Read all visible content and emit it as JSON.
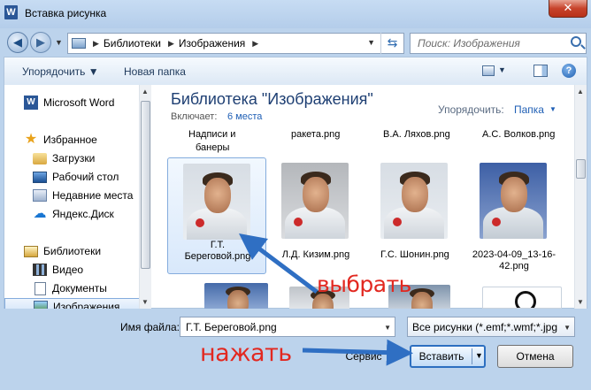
{
  "window": {
    "title": "Вставка рисунка",
    "app_icon_letter": "W",
    "close_glyph": "✕"
  },
  "navigation": {
    "back_glyph": "◀",
    "forward_glyph": "▶",
    "recent_drop_glyph": "▼",
    "breadcrumbs": [
      "Библиотеки",
      "Изображения"
    ],
    "crumb_sep_glyph": "▶",
    "addr_drop_glyph": "▼",
    "refresh_glyph": "⇆",
    "search_placeholder": "Поиск: Изображения"
  },
  "toolbar": {
    "organize_label": "Упорядочить ▼",
    "new_folder_label": "Новая папка",
    "view_drop_glyph": "▼",
    "help_glyph": "?"
  },
  "sidebar": {
    "items": [
      {
        "label": "Microsoft Word",
        "icon": "word-icon"
      },
      {
        "label": "Избранное",
        "icon": "star-icon"
      },
      {
        "label": "Загрузки",
        "icon": "downloads-folder-icon"
      },
      {
        "label": "Рабочий стол",
        "icon": "desktop-icon"
      },
      {
        "label": "Недавние места",
        "icon": "recent-places-icon"
      },
      {
        "label": "Яндекс.Диск",
        "icon": "yandex-disk-icon"
      },
      {
        "label": "Библиотеки",
        "icon": "libraries-icon"
      },
      {
        "label": "Видео",
        "icon": "video-library-icon"
      },
      {
        "label": "Документы",
        "icon": "documents-library-icon"
      },
      {
        "label": "Изображения",
        "icon": "images-library-icon"
      }
    ],
    "selected": "Изображения"
  },
  "library": {
    "title": "Библиотека \"Изображения\"",
    "includes_label": "Включает:",
    "places_link": "6 места",
    "arrange_label": "Упорядочить:",
    "arrange_value": "Папка",
    "arrange_drop_glyph": "▼"
  },
  "files": {
    "cut_row": [
      {
        "label": "Надписи и"
      },
      {
        "label": "банеры"
      },
      {
        "label": "ракета.png"
      },
      {
        "label": "В.А. Ляхов.png"
      },
      {
        "label": "А.С. Волков.png"
      }
    ],
    "tiles": [
      {
        "line1": "Г.Т.",
        "line2": "Береговой.png",
        "selected": true
      },
      {
        "line1": "Л.Д. Кизим.png",
        "line2": "",
        "selected": false
      },
      {
        "line1": "Г.С. Шонин.png",
        "line2": "",
        "selected": false
      },
      {
        "line1": "2023-04-09_13-16-",
        "line2": "42.png",
        "selected": false
      }
    ]
  },
  "footer": {
    "filename_label": "Имя файла:",
    "filename_value": "Г.Т. Береговой.png",
    "filename_drop_glyph": "▼",
    "filter_value": "Все рисунки (*.emf;*.wmf;*.jpg",
    "filter_drop_glyph": "▼",
    "service_label": "Сервис",
    "insert_label": "Вставить",
    "insert_drop_glyph": "▼",
    "cancel_label": "Отмена"
  },
  "scroll": {
    "up_glyph": "▲",
    "down_glyph": "▼"
  },
  "annotations": {
    "select_text": "выбрать",
    "press_text": "нажать",
    "color": "#e22820",
    "arrow_color": "#2f6fc3"
  }
}
